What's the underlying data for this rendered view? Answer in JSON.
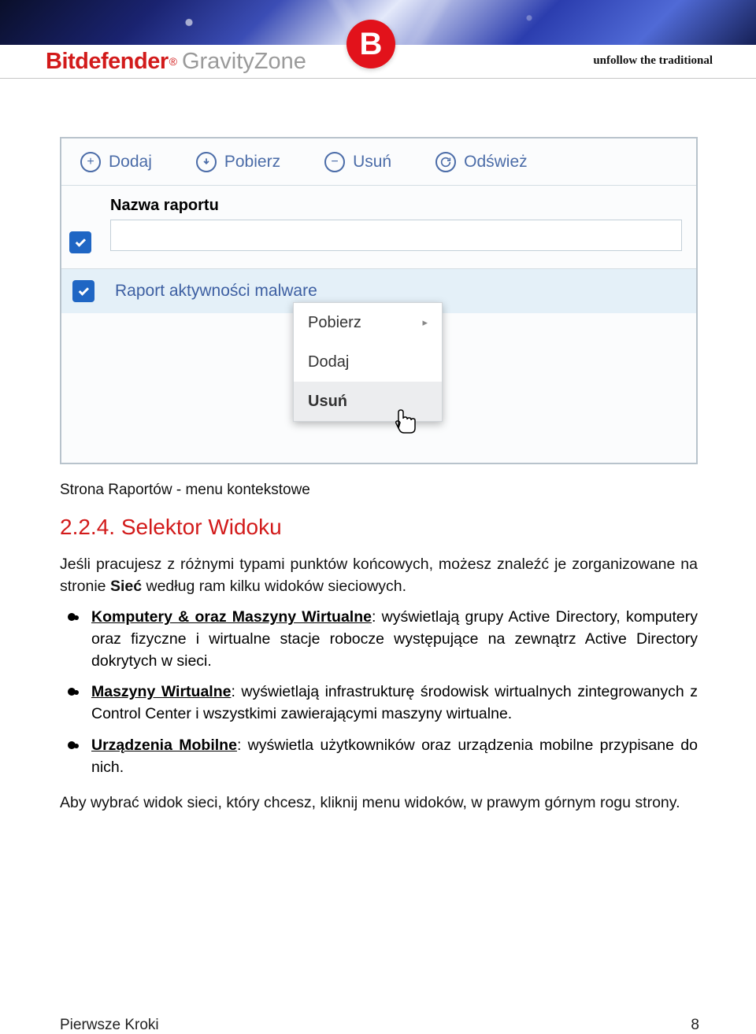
{
  "brand": {
    "name": "Bitdefender",
    "registered": "®",
    "product": "GravityZone",
    "logo_letter": "B",
    "tagline": "unfollow the traditional"
  },
  "screenshot": {
    "toolbar": {
      "add": "Dodaj",
      "download": "Pobierz",
      "remove": "Usuń",
      "refresh": "Odśwież"
    },
    "header_label": "Nazwa raportu",
    "row1": "Raport aktywności malware",
    "ctx": {
      "download": "Pobierz",
      "add": "Dodaj",
      "remove": "Usuń",
      "arrow": "▸"
    }
  },
  "caption": "Strona Raportów - menu kontekstowe",
  "heading": "2.2.4. Selektor Widoku",
  "intro_a": "Jeśli pracujesz z różnymi typami punktów końcowych, możesz znaleźć je zorganizowane na stronie ",
  "intro_b_strong": "Sieć",
  "intro_c": " według ram kilku widoków sieciowych.",
  "bullets": {
    "b1_t": "Komputery & oraz Maszyny Wirtualne",
    "b1_r": ": wyświetlają grupy Active Directory, komputery oraz fizyczne i wirtualne stacje robocze występujące na zewnątrz Active Directory dokrytych w sieci.",
    "b2_t": "Maszyny Wirtualne",
    "b2_r": ": wyświetlają infrastrukturę środowisk wirtualnych zintegrowanych z Control Center i wszystkimi zawierającymi maszyny wirtualne.",
    "b3_t": "Urządzenia Mobilne",
    "b3_r": ": wyświetla użytkowników oraz urządzenia mobilne przypisane do nich."
  },
  "outro": "Aby wybrać widok sieci, który chcesz, kliknij menu widoków, w prawym górnym rogu strony.",
  "footer": {
    "left": "Pierwsze Kroki",
    "right": "8"
  }
}
